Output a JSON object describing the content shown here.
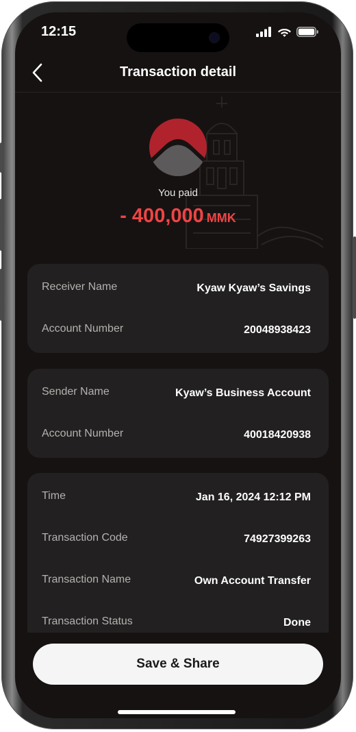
{
  "status_bar": {
    "time": "12:15",
    "icons": [
      "cellular-signal-icon",
      "wifi-icon",
      "battery-icon"
    ]
  },
  "header": {
    "back_icon": "chevron-left-icon",
    "title": "Transaction detail"
  },
  "summary": {
    "label": "You paid",
    "amount": "- 400,000",
    "currency": "MMK",
    "amount_color": "#ef4444"
  },
  "receiver": {
    "name_label": "Receiver Name",
    "name_value": "Kyaw Kyaw’s Savings",
    "account_label": "Account Number",
    "account_value": "20048938423"
  },
  "sender": {
    "name_label": "Sender Name",
    "name_value": "Kyaw’s Business Account",
    "account_label": "Account Number",
    "account_value": "40018420938"
  },
  "details": {
    "time_label": "Time",
    "time_value": "Jan 16, 2024 12:12 PM",
    "code_label": "Transaction Code",
    "code_value": "74927399263",
    "name_label": "Transaction Name",
    "name_value": "Own Account Transfer",
    "status_label": "Transaction Status",
    "status_value": "Done"
  },
  "actions": {
    "save_share_label": "Save & Share"
  },
  "colors": {
    "background": "#171212",
    "card": "#222020",
    "accent_red": "#b0232d",
    "amount_red": "#ef4444"
  }
}
